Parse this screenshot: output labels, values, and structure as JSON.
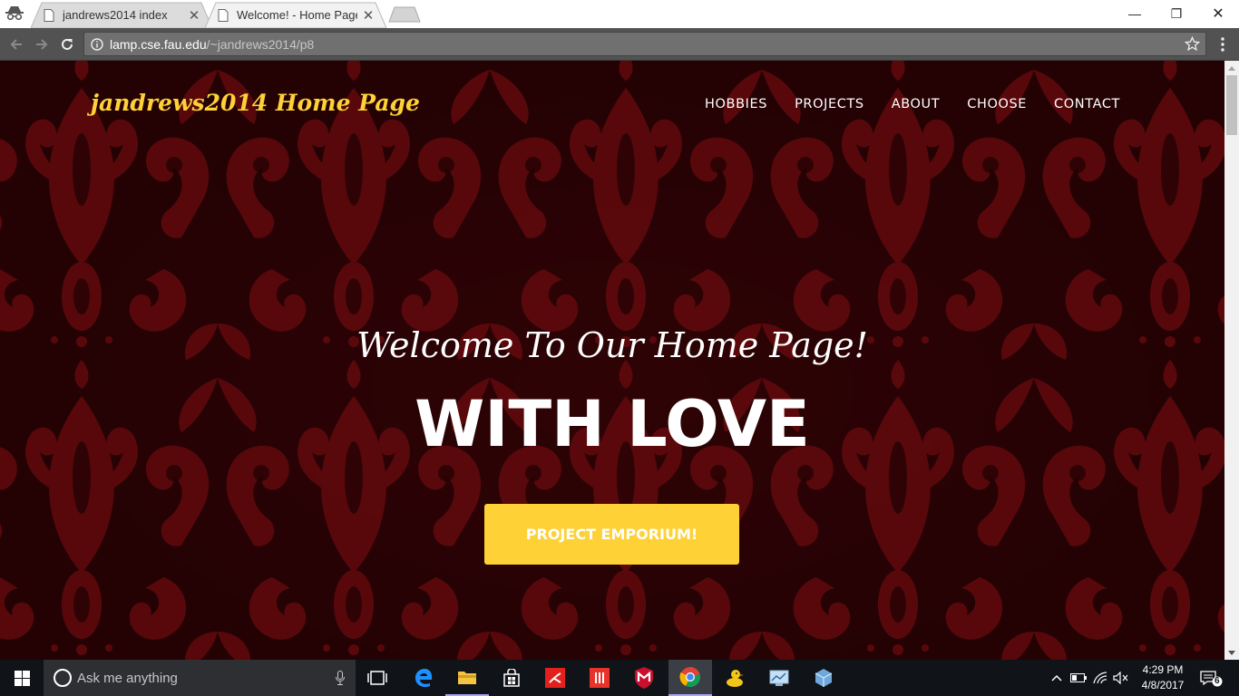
{
  "browser": {
    "tabs": [
      {
        "title": "jandrews2014 index",
        "close": "✕"
      },
      {
        "title": "Welcome! - Home Page",
        "close": "✕"
      }
    ],
    "url_host": "lamp.cse.fau.edu",
    "url_path": "/~jandrews2014/p8",
    "window_controls": {
      "minimize": "—",
      "maximize": "❐",
      "close": "✕"
    }
  },
  "page": {
    "brand": "jandrews2014 Home Page",
    "nav": [
      "HOBBIES",
      "PROJECTS",
      "ABOUT",
      "CHOOSE",
      "CONTACT"
    ],
    "hero_subtitle": "Welcome To Our Home Page!",
    "hero_title": "WITH LOVE",
    "cta_label": "PROJECT EMPORIUM!",
    "colors": {
      "accent": "#fed136",
      "background": "#3d0508",
      "pattern": "#8a0d12"
    }
  },
  "taskbar": {
    "search_placeholder": "Ask me anything",
    "apps": [
      "task-view-icon",
      "edge-icon",
      "file-explorer-icon",
      "store-icon",
      "acrobat-icon",
      "app-red-icon",
      "mcafee-icon",
      "chrome-icon",
      "duck-icon",
      "network-manager-icon",
      "virtualbox-icon"
    ],
    "time": "4:29 PM",
    "date": "4/8/2017",
    "notification_count": "6"
  }
}
